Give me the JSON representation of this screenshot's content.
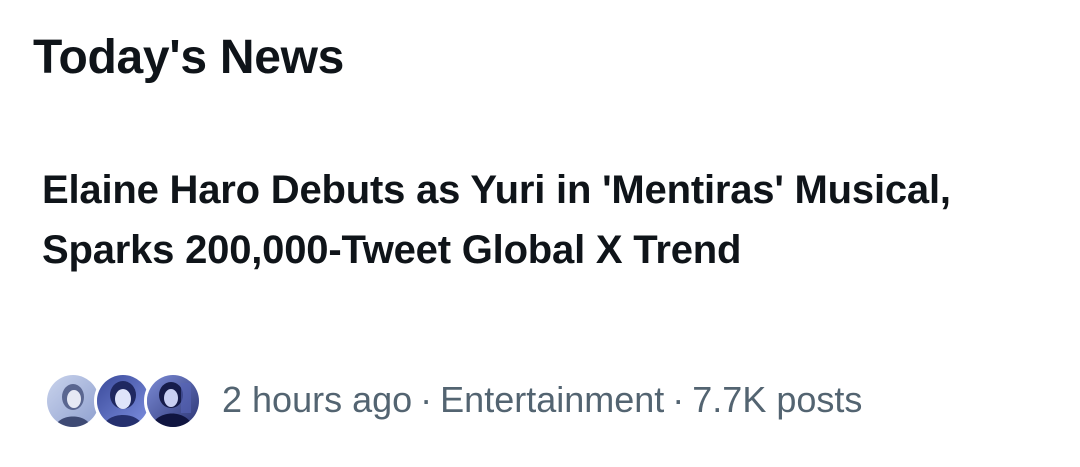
{
  "section": {
    "title": "Today's News"
  },
  "news_item": {
    "headline": "Elaine Haro Debuts as Yuri in 'Mentiras' Musical, Sparks 200,000-Tweet Global X Trend",
    "time_ago": "2 hours ago",
    "separator": "·",
    "category": "Entertainment",
    "post_count": "7.7K posts",
    "avatars": [
      "avatar-photo-1",
      "avatar-photo-2",
      "avatar-photo-3"
    ]
  },
  "colors": {
    "text_primary": "#0f1419",
    "text_secondary": "#536471",
    "background": "#ffffff",
    "avatar_tint": "#7b8bd6"
  }
}
